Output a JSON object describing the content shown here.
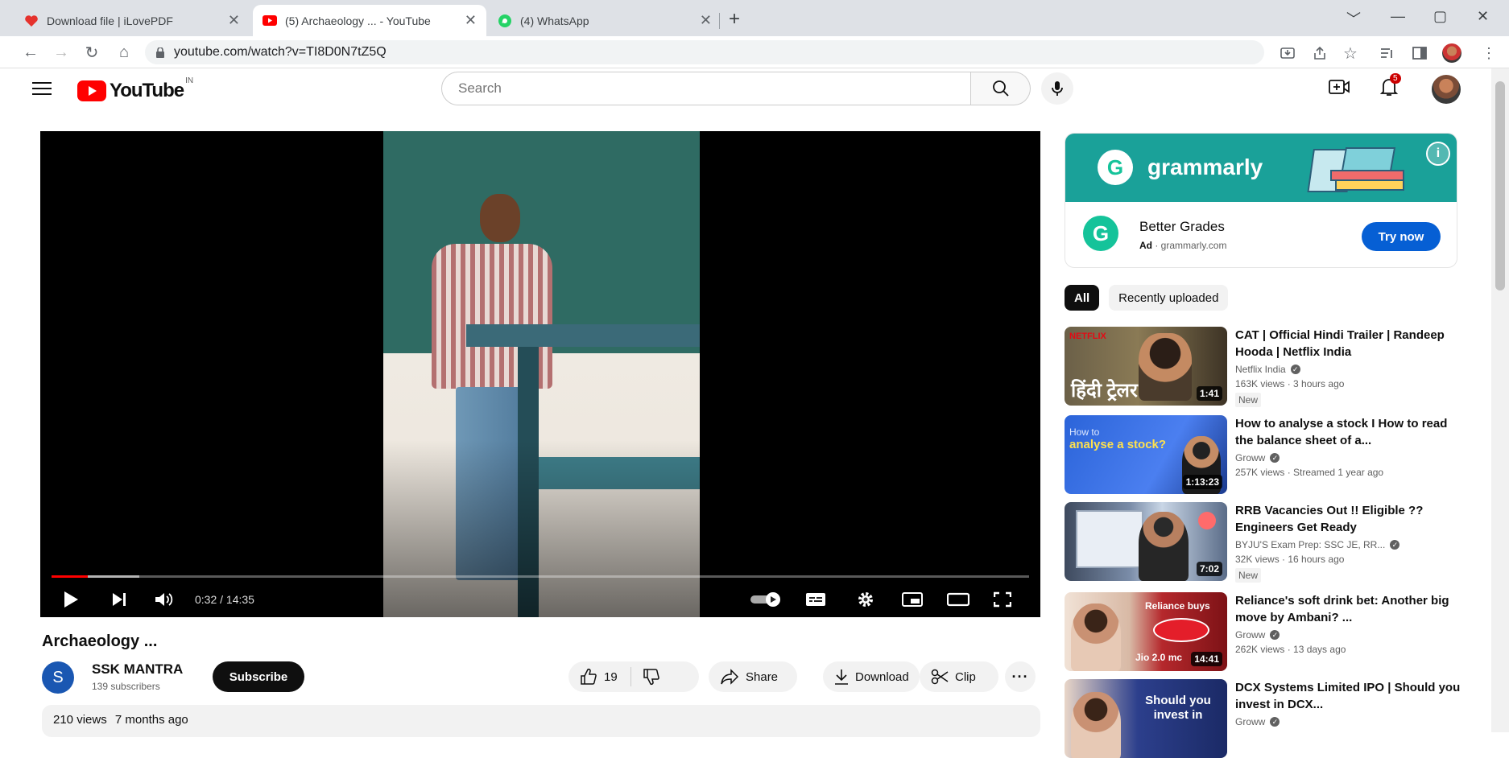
{
  "browser": {
    "tabs": [
      {
        "title": "Download file | iLovePDF"
      },
      {
        "title": "(5) Archaeology ... - YouTube"
      },
      {
        "title": "(4) WhatsApp"
      }
    ],
    "url": "youtube.com/watch?v=TI8D0N7tZ5Q"
  },
  "masthead": {
    "logo_text": "YouTube",
    "country_code": "IN",
    "search_placeholder": "Search",
    "notification_count": "5"
  },
  "player": {
    "time": "0:32 / 14:35",
    "progress_fraction": 0.037,
    "buffer_fraction": 0.09
  },
  "video": {
    "title": "Archaeology ...",
    "channel_initial": "S",
    "channel_name": "SSK MANTRA",
    "subscribers": "139 subscribers",
    "subscribe_label": "Subscribe",
    "like_count": "19",
    "share_label": "Share",
    "download_label": "Download",
    "clip_label": "Clip",
    "views": "210 views",
    "age": "7 months ago"
  },
  "ad": {
    "brand": "grammarly",
    "headline": "Better Grades",
    "ad_label": "Ad",
    "domain": "grammarly.com",
    "cta": "Try now"
  },
  "chips": [
    {
      "label": "All"
    },
    {
      "label": "Recently uploaded"
    }
  ],
  "recommendations": [
    {
      "title": "CAT | Official Hindi Trailer | Randeep Hooda | Netflix India",
      "channel": "Netflix India",
      "stats": "163K views · 3 hours ago",
      "badge": "New",
      "duration": "1:41",
      "thumb_text": "हिंदी ट्रेलर",
      "thumb_tag": "NETFLIX"
    },
    {
      "title": "How to analyse a stock I How to read the balance sheet of a...",
      "channel": "Groww",
      "stats": "257K views · Streamed 1 year ago",
      "badge": "",
      "duration": "1:13:23",
      "thumb_text": "analyse a stock?",
      "thumb_tag": "How to"
    },
    {
      "title": "RRB Vacancies Out !! Eligible ?? Engineers Get Ready",
      "channel": "BYJU'S Exam Prep: SSC JE, RR...",
      "stats": "32K views · 16 hours ago",
      "badge": "New",
      "duration": "7:02",
      "thumb_text": "",
      "thumb_tag": ""
    },
    {
      "title": "Reliance's soft drink bet: Another big move by Ambani? ...",
      "channel": "Groww",
      "stats": "262K views · 13 days ago",
      "badge": "",
      "duration": "14:41",
      "thumb_text": "Reliance buys",
      "thumb_tag": "Jio 2.0 mc"
    },
    {
      "title": "DCX Systems Limited IPO | Should you invest in DCX...",
      "channel": "Groww",
      "stats": "",
      "badge": "",
      "duration": "",
      "thumb_text": "Should you invest in",
      "thumb_tag": ""
    }
  ]
}
